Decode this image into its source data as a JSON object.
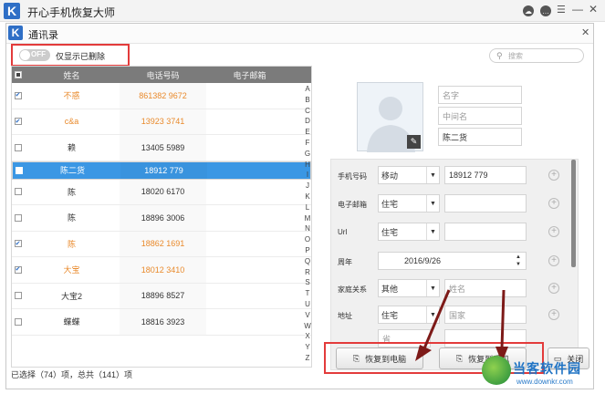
{
  "app": {
    "title": "开心手机恢复大师",
    "logo_letter": "K"
  },
  "dialog": {
    "title": "通讯录",
    "logo_letter": "K"
  },
  "filter": {
    "toggle_text": "OFF",
    "label": "仅显示已删除"
  },
  "search": {
    "placeholder": "搜索"
  },
  "table": {
    "headers": [
      "姓名",
      "电话号码",
      "电子邮箱"
    ],
    "rows": [
      {
        "checked": true,
        "name": "不惑",
        "phone": "861382   9672",
        "orange": true
      },
      {
        "checked": true,
        "name": "c&a",
        "phone": "13923   3741",
        "orange": true
      },
      {
        "checked": false,
        "name": "赖",
        "phone": "13405   5989",
        "orange": false
      },
      {
        "checked": false,
        "name": "陈二货",
        "phone": "18912   779",
        "orange": false,
        "selected": true
      },
      {
        "checked": false,
        "name": "陈",
        "phone": "18020   6170",
        "orange": false
      },
      {
        "checked": false,
        "name": "陈",
        "phone": "18896   3006",
        "orange": false
      },
      {
        "checked": true,
        "name": "陈",
        "phone": "18862   1691",
        "orange": true
      },
      {
        "checked": true,
        "name": "大宝",
        "phone": "18012   3410",
        "orange": true
      },
      {
        "checked": false,
        "name": "大宝2",
        "phone": "18896   8527",
        "orange": false
      },
      {
        "checked": false,
        "name": "蝶蝶",
        "phone": "18816   3923",
        "orange": false
      }
    ],
    "alphabet": [
      "A",
      "B",
      "C",
      "D",
      "E",
      "F",
      "G",
      "H",
      "I",
      "J",
      "K",
      "L",
      "M",
      "N",
      "O",
      "P",
      "Q",
      "R",
      "S",
      "T",
      "U",
      "V",
      "W",
      "X",
      "Y",
      "Z"
    ]
  },
  "status": {
    "text": "已选择（74）项，总共（141）项"
  },
  "detail": {
    "first_name_placeholder": "名字",
    "middle_name_placeholder": "中间名",
    "last_name": "陈二货",
    "phone": {
      "label": "手机号码",
      "type": "移动",
      "value": "18912   779"
    },
    "email": {
      "label": "电子邮箱",
      "type": "住宅"
    },
    "url": {
      "label": "Url",
      "type": "住宅"
    },
    "anniversary": {
      "label": "周年",
      "value": "2016/9/26"
    },
    "family": {
      "label": "家庭关系",
      "type": "其他",
      "placeholder": "姓名"
    },
    "address": {
      "label": "地址",
      "type": "住宅",
      "country_placeholder": "国家",
      "province_placeholder": "省"
    }
  },
  "buttons": {
    "restore_pc": "恢复到电脑",
    "restore_phone": "恢复到手机",
    "close": "关闭"
  },
  "watermark": {
    "name": "当客软件园",
    "url": "www.downkr.com"
  },
  "colors": {
    "accent": "#3b97e4",
    "highlight": "#e33b3b",
    "orange_text": "#e98a2c"
  }
}
